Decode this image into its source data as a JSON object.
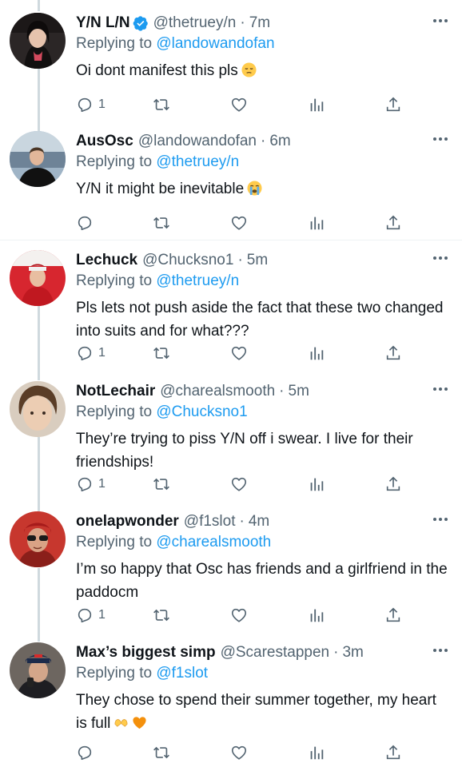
{
  "icons": {
    "reply": "reply-icon",
    "retweet": "retweet-icon",
    "like": "heart-icon",
    "stats": "analytics-icon",
    "share": "share-icon",
    "more": "more-icon",
    "verified": "verified-badge-icon"
  },
  "colors": {
    "link": "#1d9bf0",
    "secondary_text": "#536471",
    "thread_line": "#cfd9de"
  },
  "reply_prefix": "Replying to",
  "separator": "·",
  "tweets": [
    {
      "display_name": "Y/N L/N",
      "verified": true,
      "handle": "@thetruey/n",
      "time": "7m",
      "replying_to": "@landowandofan",
      "text": "Oi dont manifest this pls",
      "emoji": "pensive-face",
      "reply_count": "1"
    },
    {
      "display_name": "AusOsc",
      "handle": "@landowandofan",
      "time": "6m",
      "replying_to": "@thetruey/n",
      "text": "Y/N it might be inevitable",
      "emoji": "loudly-crying-face",
      "reply_count": ""
    },
    {
      "display_name": "Lechuck",
      "handle": "@Chucksno1",
      "time": "5m",
      "replying_to": "@thetruey/n",
      "text": "Pls lets not push aside the fact that these two changed into suits and for what???",
      "reply_count": "1"
    },
    {
      "display_name": "NotLechair",
      "handle": "@charealsmooth",
      "time": "5m",
      "replying_to": "@Chucksno1",
      "text": "They’re trying to piss Y/N off i swear. I live for their friendships!",
      "reply_count": "1"
    },
    {
      "display_name": "onelapwonder",
      "handle": "@f1slot",
      "time": "4m",
      "replying_to": "@charealsmooth",
      "text": "I’m so happy that Osc has friends and a girlfriend in the paddocm",
      "reply_count": "1"
    },
    {
      "display_name": "Max’s biggest simp",
      "handle": "@Scarestappen",
      "time": "3m",
      "replying_to": "@f1slot",
      "text": "They chose to spend their summer together, my heart is full",
      "emoji": "heart-hands, orange-heart",
      "reply_count": ""
    }
  ]
}
